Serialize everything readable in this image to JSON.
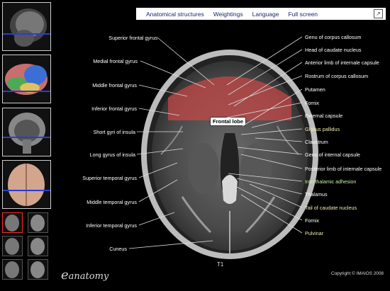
{
  "menu": {
    "items": [
      "Anatomical structures",
      "Weightings",
      "Language",
      "Full screen"
    ]
  },
  "labels_left": [
    "Superior frontal gyrus",
    "Medial frontal gyrus",
    "Middle frontal gyrus",
    "Inferior frontal gyrus",
    "Short gyri of insula",
    "Long gyrus of insula",
    "Superior temporal gyrus",
    "Middle temporal gyrus",
    "Inferior temporal gyrus",
    "Cuneus"
  ],
  "labels_right": [
    "Genu of corpus callosum",
    "Head of caudate nucleus",
    "Anterior limb of internale capsule",
    "Rostrum of corpus callosum",
    "Putamen",
    "Fornix",
    "External capsule",
    "Globus pallidus",
    "Claustrum",
    "Genu of internal capsule",
    "Posterior limb of internale capsule",
    "Interthalamic adhesion",
    "Thalamus",
    "Tail of caudate nucleus",
    "Fornix",
    "Pulvinar"
  ],
  "highlight_label": "Frontal lobe",
  "sequence": "T1",
  "logo_text": "anatomy",
  "copyright": "Copyright © IMAIOS 2008",
  "colors": {
    "highlight": "#c84646",
    "green_label": "#c8f0a0",
    "yellow_label": "#f0ebb0"
  }
}
